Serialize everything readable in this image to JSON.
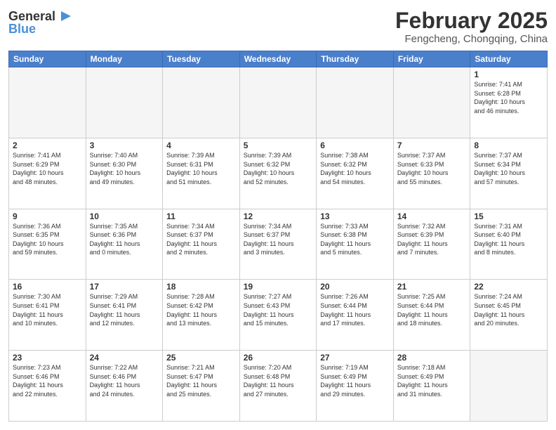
{
  "header": {
    "logo": {
      "line1": "General",
      "line2": "Blue"
    },
    "title": "February 2025",
    "location": "Fengcheng, Chongqing, China"
  },
  "days_of_week": [
    "Sunday",
    "Monday",
    "Tuesday",
    "Wednesday",
    "Thursday",
    "Friday",
    "Saturday"
  ],
  "weeks": [
    {
      "days": [
        {
          "num": "",
          "info": "",
          "empty": true
        },
        {
          "num": "",
          "info": "",
          "empty": true
        },
        {
          "num": "",
          "info": "",
          "empty": true
        },
        {
          "num": "",
          "info": "",
          "empty": true
        },
        {
          "num": "",
          "info": "",
          "empty": true
        },
        {
          "num": "",
          "info": "",
          "empty": true
        },
        {
          "num": "1",
          "info": "Sunrise: 7:41 AM\nSunset: 6:28 PM\nDaylight: 10 hours\nand 46 minutes."
        }
      ]
    },
    {
      "days": [
        {
          "num": "2",
          "info": "Sunrise: 7:41 AM\nSunset: 6:29 PM\nDaylight: 10 hours\nand 48 minutes."
        },
        {
          "num": "3",
          "info": "Sunrise: 7:40 AM\nSunset: 6:30 PM\nDaylight: 10 hours\nand 49 minutes."
        },
        {
          "num": "4",
          "info": "Sunrise: 7:39 AM\nSunset: 6:31 PM\nDaylight: 10 hours\nand 51 minutes."
        },
        {
          "num": "5",
          "info": "Sunrise: 7:39 AM\nSunset: 6:32 PM\nDaylight: 10 hours\nand 52 minutes."
        },
        {
          "num": "6",
          "info": "Sunrise: 7:38 AM\nSunset: 6:32 PM\nDaylight: 10 hours\nand 54 minutes."
        },
        {
          "num": "7",
          "info": "Sunrise: 7:37 AM\nSunset: 6:33 PM\nDaylight: 10 hours\nand 55 minutes."
        },
        {
          "num": "8",
          "info": "Sunrise: 7:37 AM\nSunset: 6:34 PM\nDaylight: 10 hours\nand 57 minutes."
        }
      ]
    },
    {
      "days": [
        {
          "num": "9",
          "info": "Sunrise: 7:36 AM\nSunset: 6:35 PM\nDaylight: 10 hours\nand 59 minutes."
        },
        {
          "num": "10",
          "info": "Sunrise: 7:35 AM\nSunset: 6:36 PM\nDaylight: 11 hours\nand 0 minutes."
        },
        {
          "num": "11",
          "info": "Sunrise: 7:34 AM\nSunset: 6:37 PM\nDaylight: 11 hours\nand 2 minutes."
        },
        {
          "num": "12",
          "info": "Sunrise: 7:34 AM\nSunset: 6:37 PM\nDaylight: 11 hours\nand 3 minutes."
        },
        {
          "num": "13",
          "info": "Sunrise: 7:33 AM\nSunset: 6:38 PM\nDaylight: 11 hours\nand 5 minutes."
        },
        {
          "num": "14",
          "info": "Sunrise: 7:32 AM\nSunset: 6:39 PM\nDaylight: 11 hours\nand 7 minutes."
        },
        {
          "num": "15",
          "info": "Sunrise: 7:31 AM\nSunset: 6:40 PM\nDaylight: 11 hours\nand 8 minutes."
        }
      ]
    },
    {
      "days": [
        {
          "num": "16",
          "info": "Sunrise: 7:30 AM\nSunset: 6:41 PM\nDaylight: 11 hours\nand 10 minutes."
        },
        {
          "num": "17",
          "info": "Sunrise: 7:29 AM\nSunset: 6:41 PM\nDaylight: 11 hours\nand 12 minutes."
        },
        {
          "num": "18",
          "info": "Sunrise: 7:28 AM\nSunset: 6:42 PM\nDaylight: 11 hours\nand 13 minutes."
        },
        {
          "num": "19",
          "info": "Sunrise: 7:27 AM\nSunset: 6:43 PM\nDaylight: 11 hours\nand 15 minutes."
        },
        {
          "num": "20",
          "info": "Sunrise: 7:26 AM\nSunset: 6:44 PM\nDaylight: 11 hours\nand 17 minutes."
        },
        {
          "num": "21",
          "info": "Sunrise: 7:25 AM\nSunset: 6:44 PM\nDaylight: 11 hours\nand 18 minutes."
        },
        {
          "num": "22",
          "info": "Sunrise: 7:24 AM\nSunset: 6:45 PM\nDaylight: 11 hours\nand 20 minutes."
        }
      ]
    },
    {
      "days": [
        {
          "num": "23",
          "info": "Sunrise: 7:23 AM\nSunset: 6:46 PM\nDaylight: 11 hours\nand 22 minutes."
        },
        {
          "num": "24",
          "info": "Sunrise: 7:22 AM\nSunset: 6:46 PM\nDaylight: 11 hours\nand 24 minutes."
        },
        {
          "num": "25",
          "info": "Sunrise: 7:21 AM\nSunset: 6:47 PM\nDaylight: 11 hours\nand 25 minutes."
        },
        {
          "num": "26",
          "info": "Sunrise: 7:20 AM\nSunset: 6:48 PM\nDaylight: 11 hours\nand 27 minutes."
        },
        {
          "num": "27",
          "info": "Sunrise: 7:19 AM\nSunset: 6:49 PM\nDaylight: 11 hours\nand 29 minutes."
        },
        {
          "num": "28",
          "info": "Sunrise: 7:18 AM\nSunset: 6:49 PM\nDaylight: 11 hours\nand 31 minutes."
        },
        {
          "num": "",
          "info": "",
          "empty": true
        }
      ]
    }
  ]
}
